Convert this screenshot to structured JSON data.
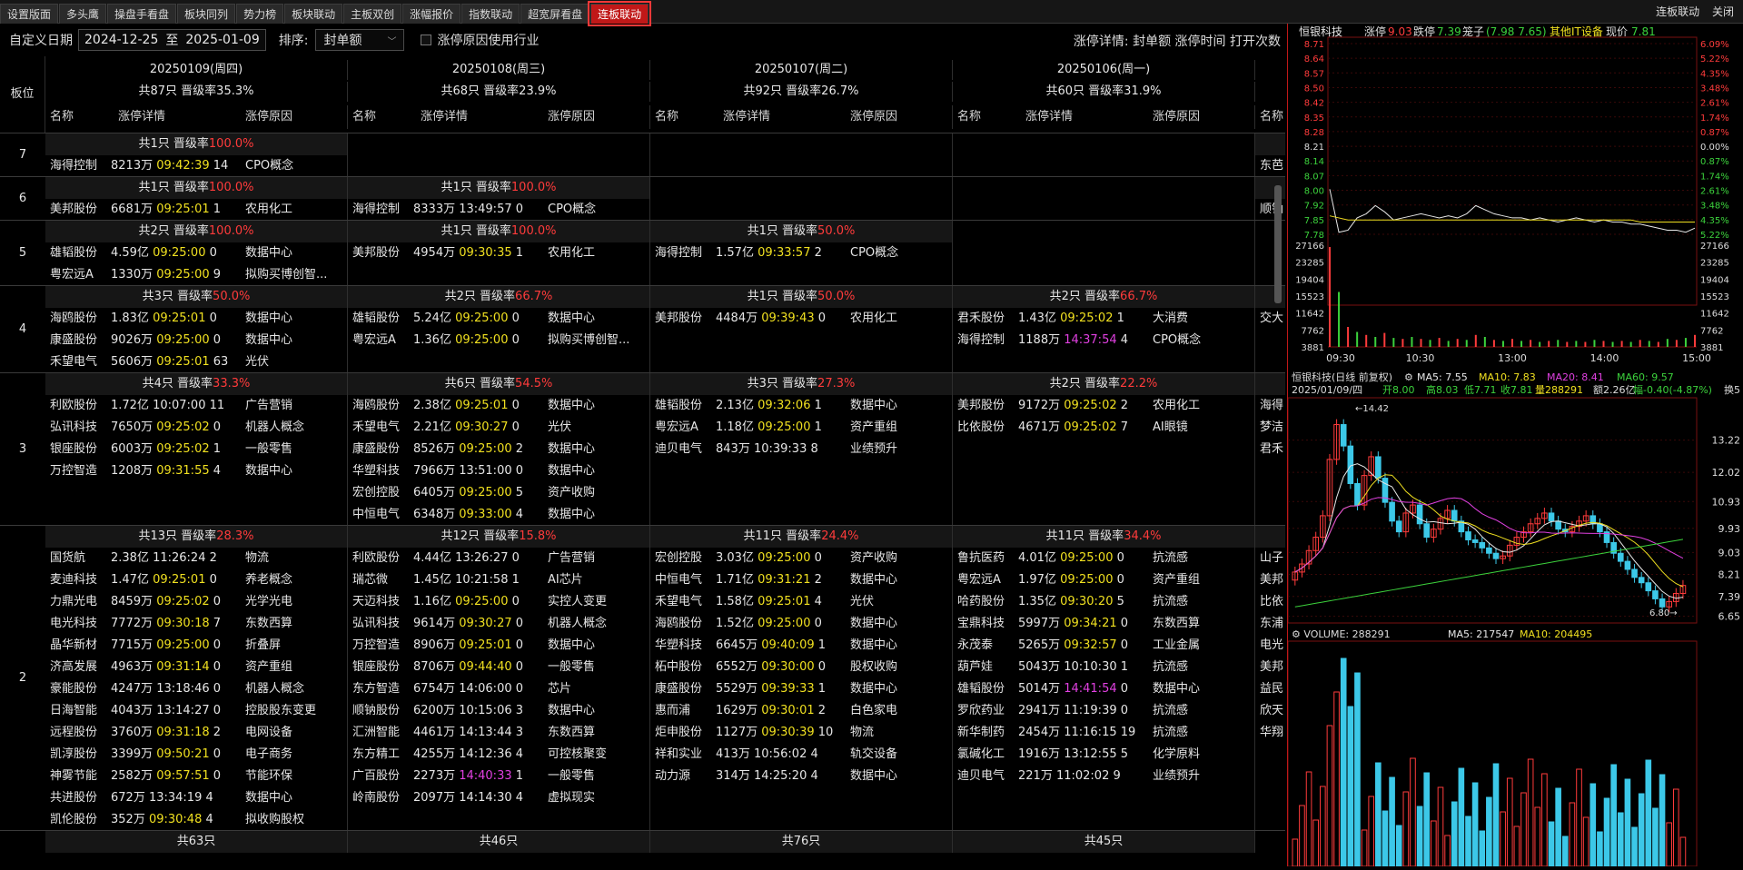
{
  "tabs": [
    "设置版面",
    "多头鹰",
    "操盘手看盘",
    "板块同列",
    "势力榜",
    "板块联动",
    "主板双创",
    "涨幅报价",
    "指数联动",
    "超宽屏看盘",
    "连板联动"
  ],
  "active_tab": "连板联动",
  "tabbar_right": {
    "title": "连板联动",
    "close": "关闭"
  },
  "toolbar": {
    "date_label": "自定义日期",
    "date_from": "2024-12-25",
    "to": "至",
    "date_to": "2025-01-09",
    "sort_label": "排序:",
    "sort_value": "封单额",
    "checkbox_label": "涨停原因使用行业",
    "detail": "涨停详情: 封单额 涨停时间 打开次数"
  },
  "board_label": "板位",
  "col_headers": [
    "名称",
    "涨停详情",
    "涨停原因"
  ],
  "days": [
    {
      "date": "20250109(周四)",
      "summary": "共87只 晋级率35.3%"
    },
    {
      "date": "20250108(周三)",
      "summary": "共68只 晋级率23.9%"
    },
    {
      "date": "20250107(周二)",
      "summary": "共92只 晋级率26.7%"
    },
    {
      "date": "20250106(周一)",
      "summary": "共60只 晋级率31.9%"
    }
  ],
  "levels": [
    {
      "num": "7",
      "lines": 2,
      "blocks": [
        {
          "count": "共1只",
          "rate": "100.0%",
          "rows": [
            [
              "海得控制",
              "8213万",
              "09:42:39",
              "14",
              "CPO概念"
            ]
          ]
        },
        null,
        null,
        null
      ],
      "peek": [
        "东芭"
      ]
    },
    {
      "num": "6",
      "lines": 2,
      "blocks": [
        {
          "count": "共1只",
          "rate": "100.0%",
          "rows": [
            [
              "美邦股份",
              "6681万",
              "09:25:01",
              "1",
              "农用化工"
            ]
          ]
        },
        {
          "count": "共1只",
          "rate": "100.0%",
          "rows": [
            [
              "海得控制",
              "8333万",
              "13:49:57",
              "0",
              "CPO概念"
            ]
          ]
        },
        null,
        null
      ],
      "peek": [
        "顺钠"
      ]
    },
    {
      "num": "5",
      "lines": 3,
      "blocks": [
        {
          "count": "共2只",
          "rate": "100.0%",
          "rows": [
            [
              "雄韬股份",
              "4.59亿",
              "09:25:00",
              "0",
              "数据中心"
            ],
            [
              "粤宏远A",
              "1330万",
              "09:25:00",
              "9",
              "拟购买博创智..."
            ]
          ]
        },
        {
          "count": "共1只",
          "rate": "100.0%",
          "rows": [
            [
              "美邦股份",
              "4954万",
              "09:30:35",
              "1",
              "农用化工"
            ]
          ]
        },
        {
          "count": "共1只",
          "rate": "50.0%",
          "rows": [
            [
              "海得控制",
              "1.57亿",
              "09:33:57",
              "2",
              "CPO概念"
            ]
          ]
        },
        null
      ],
      "peek": []
    },
    {
      "num": "4",
      "lines": 4,
      "blocks": [
        {
          "count": "共3只",
          "rate": "50.0%",
          "rows": [
            [
              "海鸥股份",
              "1.83亿",
              "09:25:01",
              "0",
              "数据中心"
            ],
            [
              "康盛股份",
              "9026万",
              "09:25:00",
              "0",
              "数据中心"
            ],
            [
              "禾望电气",
              "5606万",
              "09:25:01",
              "63",
              "光伏"
            ]
          ]
        },
        {
          "count": "共2只",
          "rate": "66.7%",
          "rows": [
            [
              "雄韬股份",
              "5.24亿",
              "09:25:00",
              "0",
              "数据中心"
            ],
            [
              "粤宏远A",
              "1.36亿",
              "09:25:00",
              "0",
              "拟购买博创智..."
            ]
          ]
        },
        {
          "count": "共1只",
          "rate": "50.0%",
          "rows": [
            [
              "美邦股份",
              "4484万",
              "09:39:43",
              "0",
              "农用化工"
            ]
          ]
        },
        {
          "count": "共2只",
          "rate": "66.7%",
          "rows": [
            [
              "君禾股份",
              "1.43亿",
              "09:25:02",
              "1",
              "大消费"
            ],
            [
              "海得控制",
              "1188万",
              "14:37:54",
              "4",
              "CPO概念"
            ]
          ]
        }
      ],
      "peek": [
        "交大"
      ]
    },
    {
      "num": "3",
      "lines": 7,
      "blocks": [
        {
          "count": "共4只",
          "rate": "33.3%",
          "rows": [
            [
              "利欧股份",
              "1.72亿",
              "10:07:00",
              "11",
              "广告营销"
            ],
            [
              "弘讯科技",
              "7650万",
              "09:25:02",
              "0",
              "机器人概念"
            ],
            [
              "银座股份",
              "6003万",
              "09:25:02",
              "1",
              "一般零售"
            ],
            [
              "万控智造",
              "1208万",
              "09:31:55",
              "4",
              "数据中心"
            ]
          ]
        },
        {
          "count": "共6只",
          "rate": "54.5%",
          "rows": [
            [
              "海鸥股份",
              "2.38亿",
              "09:25:01",
              "0",
              "数据中心"
            ],
            [
              "禾望电气",
              "2.21亿",
              "09:30:27",
              "0",
              "光伏"
            ],
            [
              "康盛股份",
              "8526万",
              "09:25:00",
              "2",
              "数据中心"
            ],
            [
              "华塑科技",
              "7966万",
              "13:51:00",
              "0",
              "数据中心"
            ],
            [
              "宏创控股",
              "6405万",
              "09:25:00",
              "5",
              "资产收购"
            ],
            [
              "中恒电气",
              "6348万",
              "09:33:00",
              "4",
              "数据中心"
            ]
          ]
        },
        {
          "count": "共3只",
          "rate": "27.3%",
          "rows": [
            [
              "雄韬股份",
              "2.13亿",
              "09:32:06",
              "1",
              "数据中心"
            ],
            [
              "粤宏远A",
              "1.18亿",
              "09:25:00",
              "1",
              "资产重组"
            ],
            [
              "迪贝电气",
              "843万",
              "10:39:33",
              "8",
              "业绩预升"
            ]
          ]
        },
        {
          "count": "共2只",
          "rate": "22.2%",
          "rows": [
            [
              "美邦股份",
              "9172万",
              "09:25:02",
              "2",
              "农用化工"
            ],
            [
              "比依股份",
              "4671万",
              "09:25:02",
              "7",
              "AI眼镜"
            ]
          ]
        }
      ],
      "peek": [
        "海得",
        "梦洁",
        "君禾"
      ]
    },
    {
      "num": "2",
      "lines": 14,
      "blocks": [
        {
          "count": "共13只",
          "rate": "28.3%",
          "rows": [
            [
              "国货航",
              "2.38亿",
              "11:26:24",
              "2",
              "物流"
            ],
            [
              "麦迪科技",
              "1.47亿",
              "09:25:01",
              "0",
              "养老概念"
            ],
            [
              "力鼎光电",
              "8459万",
              "09:25:02",
              "0",
              "光学光电"
            ],
            [
              "电光科技",
              "7772万",
              "09:30:18",
              "7",
              "东数西算"
            ],
            [
              "晶华新材",
              "7715万",
              "09:25:00",
              "0",
              "折叠屏"
            ],
            [
              "济高发展",
              "4963万",
              "09:31:14",
              "0",
              "资产重组"
            ],
            [
              "豪能股份",
              "4247万",
              "13:18:46",
              "0",
              "机器人概念"
            ],
            [
              "日海智能",
              "4043万",
              "13:14:27",
              "0",
              "控股股东变更"
            ],
            [
              "远程股份",
              "3760万",
              "09:31:18",
              "2",
              "电网设备"
            ],
            [
              "凯淳股份",
              "3399万",
              "09:50:21",
              "0",
              "电子商务"
            ],
            [
              "神雾节能",
              "2582万",
              "09:57:51",
              "0",
              "节能环保"
            ],
            [
              "共进股份",
              "672万",
              "13:34:19",
              "4",
              "数据中心"
            ],
            [
              "凯伦股份",
              "352万",
              "09:30:48",
              "4",
              "拟收购股权"
            ]
          ]
        },
        {
          "count": "共12只",
          "rate": "15.8%",
          "rows": [
            [
              "利欧股份",
              "4.44亿",
              "13:26:27",
              "0",
              "广告营销"
            ],
            [
              "瑞芯微",
              "1.45亿",
              "10:21:58",
              "1",
              "AI芯片"
            ],
            [
              "天迈科技",
              "1.16亿",
              "09:25:00",
              "0",
              "实控人变更"
            ],
            [
              "弘讯科技",
              "9614万",
              "09:30:27",
              "0",
              "机器人概念"
            ],
            [
              "万控智造",
              "8906万",
              "09:25:01",
              "0",
              "数据中心"
            ],
            [
              "银座股份",
              "8706万",
              "09:44:40",
              "0",
              "一般零售"
            ],
            [
              "东方智造",
              "6754万",
              "14:06:00",
              "0",
              "芯片"
            ],
            [
              "顺钠股份",
              "6200万",
              "10:15:06",
              "3",
              "数据中心"
            ],
            [
              "汇洲智能",
              "4461万",
              "14:13:44",
              "3",
              "东数西算"
            ],
            [
              "东方精工",
              "4255万",
              "14:12:36",
              "4",
              "可控核聚变"
            ],
            [
              "广百股份",
              "2273万",
              "14:40:33",
              "1",
              "一般零售"
            ],
            [
              "岭南股份",
              "2097万",
              "14:14:30",
              "4",
              "虚拟现实"
            ]
          ]
        },
        {
          "count": "共11只",
          "rate": "24.4%",
          "rows": [
            [
              "宏创控股",
              "3.03亿",
              "09:25:00",
              "0",
              "资产收购"
            ],
            [
              "中恒电气",
              "1.71亿",
              "09:31:21",
              "2",
              "数据中心"
            ],
            [
              "禾望电气",
              "1.58亿",
              "09:25:01",
              "4",
              "光伏"
            ],
            [
              "海鸥股份",
              "1.52亿",
              "09:25:00",
              "0",
              "数据中心"
            ],
            [
              "华塑科技",
              "6645万",
              "09:40:09",
              "1",
              "数据中心"
            ],
            [
              "柘中股份",
              "6552万",
              "09:30:00",
              "0",
              "股权收购"
            ],
            [
              "康盛股份",
              "5529万",
              "09:39:33",
              "1",
              "数据中心"
            ],
            [
              "惠而浦",
              "1629万",
              "09:30:01",
              "2",
              "白色家电"
            ],
            [
              "炬申股份",
              "1127万",
              "09:30:39",
              "10",
              "物流"
            ],
            [
              "祥和实业",
              "413万",
              "10:56:02",
              "4",
              "轨交设备"
            ],
            [
              "动力源",
              "314万",
              "14:25:20",
              "4",
              "数据中心"
            ]
          ]
        },
        {
          "count": "共11只",
          "rate": "34.4%",
          "rows": [
            [
              "鲁抗医药",
              "4.01亿",
              "09:25:00",
              "0",
              "抗流感"
            ],
            [
              "粤宏远A",
              "1.97亿",
              "09:25:00",
              "0",
              "资产重组"
            ],
            [
              "哈药股份",
              "1.35亿",
              "09:30:20",
              "5",
              "抗流感"
            ],
            [
              "宝鼎科技",
              "5997万",
              "09:34:21",
              "0",
              "东数西算"
            ],
            [
              "永茂泰",
              "5265万",
              "09:32:57",
              "0",
              "工业金属"
            ],
            [
              "葫芦娃",
              "5043万",
              "10:10:30",
              "1",
              "抗流感"
            ],
            [
              "雄韬股份",
              "5014万",
              "14:41:54",
              "0",
              "数据中心"
            ],
            [
              "罗欣药业",
              "2941万",
              "11:19:39",
              "0",
              "抗流感"
            ],
            [
              "新华制药",
              "2454万",
              "11:16:15",
              "19",
              "抗流感"
            ],
            [
              "氯碱化工",
              "1916万",
              "13:12:55",
              "5",
              "化学原料"
            ],
            [
              "迪贝电气",
              "221万",
              "11:02:02",
              "9",
              "业绩预升"
            ]
          ]
        }
      ],
      "peek": [
        "山子",
        "美邦",
        "比依",
        "东浦",
        "电光",
        "美邦",
        "益民",
        "欣天",
        "华翔"
      ]
    },
    {
      "num": "",
      "lines": 1,
      "blocks": [
        {
          "count": "共63只",
          "rate": "",
          "rows": []
        },
        {
          "count": "共46只",
          "rate": "",
          "rows": []
        },
        {
          "count": "共76只",
          "rate": "",
          "rows": []
        },
        {
          "count": "共45只",
          "rate": "",
          "rows": []
        }
      ],
      "peek": []
    }
  ],
  "quote": {
    "name": "恒银科技",
    "up_stop_label": "涨停",
    "up_stop": "9.03",
    "down_stop_label": "跌停",
    "down_stop": "7.39",
    "range_label": "笼子",
    "range": "(7.98 7.65)",
    "concept": "其他IT设备",
    "price_label": "现价",
    "price": "7.81"
  },
  "intraday": {
    "left_ticks": [
      "8.71",
      "8.64",
      "8.57",
      "8.50",
      "8.42",
      "8.35",
      "8.28",
      "8.21",
      "8.14",
      "8.07",
      "8.00",
      "7.92",
      "7.85",
      "7.78"
    ],
    "right_ticks": [
      "6.09%",
      "5.22%",
      "4.35%",
      "3.48%",
      "2.61%",
      "1.74%",
      "0.87%",
      "0.00%",
      "0.87%",
      "1.74%",
      "2.61%",
      "3.48%",
      "4.35%",
      "5.22%"
    ],
    "vol_ticks": [
      "27166",
      "23285",
      "19404",
      "15523",
      "11642",
      "7762",
      "3881"
    ],
    "time_ticks": [
      "09:30",
      "10:30",
      "13:00",
      "14:00",
      "15:00"
    ],
    "prices": [
      8.0,
      7.79,
      7.8,
      7.86,
      7.88,
      7.92,
      7.89,
      7.85,
      7.86,
      7.87,
      7.88,
      7.87,
      7.86,
      7.87,
      7.86,
      7.88,
      7.92,
      7.9,
      7.88,
      7.87,
      7.86,
      7.86,
      7.85,
      7.86,
      7.85,
      7.84,
      7.85,
      7.86,
      7.85,
      7.84,
      7.85,
      7.84,
      7.84,
      7.83,
      7.83,
      7.82,
      7.81,
      7.8,
      7.8,
      7.79,
      7.81
    ],
    "avg": [
      7.87,
      7.86,
      7.85,
      7.85,
      7.85,
      7.85,
      7.85,
      7.85,
      7.85,
      7.85,
      7.85,
      7.85,
      7.85,
      7.85,
      7.85,
      7.85,
      7.85,
      7.85,
      7.85,
      7.85,
      7.85,
      7.85,
      7.85,
      7.85,
      7.85,
      7.85,
      7.85,
      7.85,
      7.85,
      7.85,
      7.85,
      7.85,
      7.85,
      7.85,
      7.84,
      7.84,
      7.84,
      7.84,
      7.84,
      7.84,
      7.84
    ]
  },
  "kline": {
    "title": "恒银科技(日线 前复权)",
    "ma5_label": "MA5: 7.55",
    "ma10_label": "MA10: 7.83",
    "ma20_label": "MA20: 8.41",
    "ma60_label": "MA60: 9.57",
    "info_date": "2025/01/09/四",
    "info_open": "开8.00",
    "info_high": "高8.03",
    "info_low": "低7.71",
    "info_close": "收7.81",
    "info_vol": "量288291",
    "info_amt": "额2.26亿",
    "info_chg": "幅-0.40(-4.87%)",
    "info_turn": "换5",
    "ticks": [
      "13.22",
      "12.02",
      "10.93",
      "9.93",
      "9.03",
      "8.21",
      "7.39",
      "6.65"
    ],
    "high_mark": "14.42",
    "low_mark": "6.80"
  },
  "volume": {
    "label": "VOLUME: 288291",
    "ma5": "MA5: 217547",
    "ma10": "MA10: 204495"
  }
}
